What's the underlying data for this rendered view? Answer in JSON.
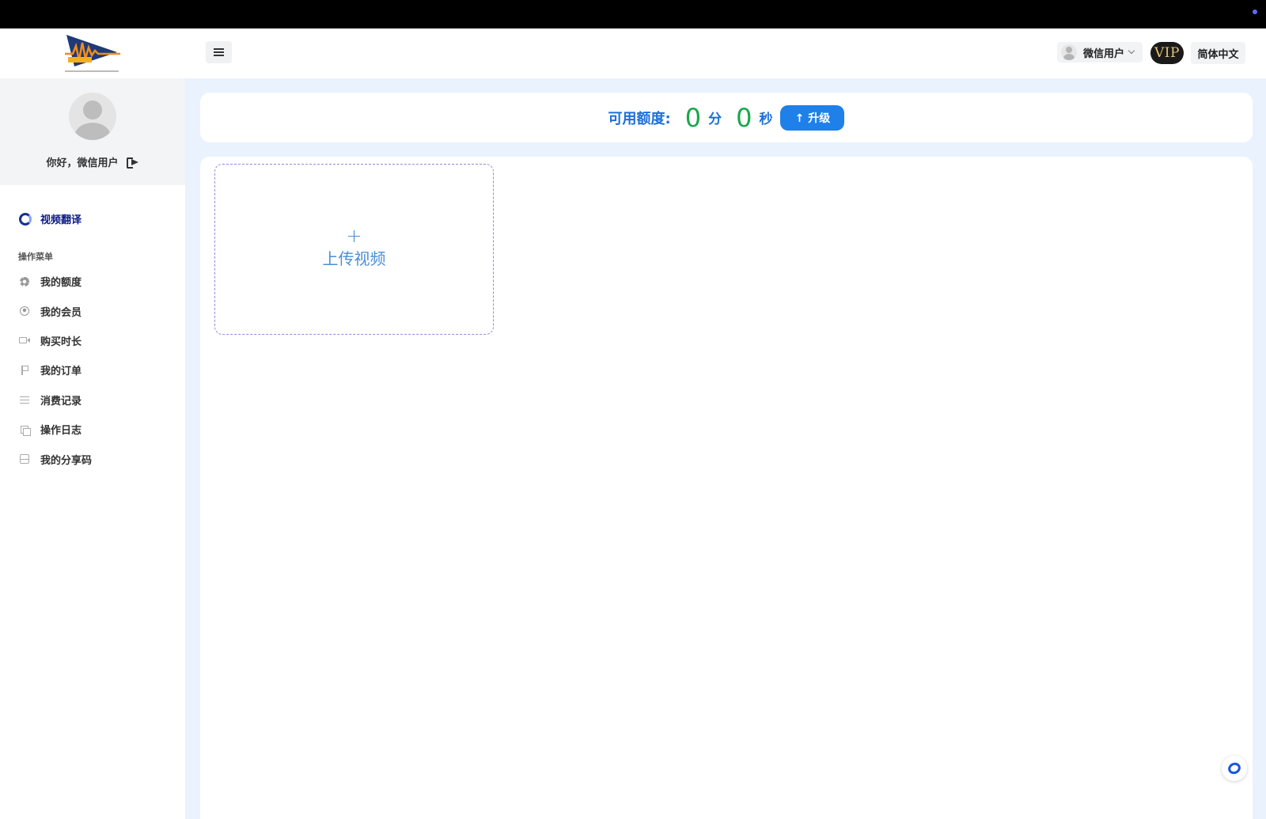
{
  "header": {
    "logo_alt": "logo",
    "user_name": "微信用户",
    "vip_label": "VIP",
    "language": "简体中文"
  },
  "sidebar": {
    "greeting": "你好，微信用户",
    "active_item": "视频翻译",
    "section_title": "操作菜单",
    "items": [
      {
        "label": "我的额度",
        "icon": "gear-icon"
      },
      {
        "label": "我的会员",
        "icon": "user-circle-icon"
      },
      {
        "label": "购买时长",
        "icon": "video-camera-icon"
      },
      {
        "label": "我的订单",
        "icon": "flag-icon"
      },
      {
        "label": "消费记录",
        "icon": "sliders-icon"
      },
      {
        "label": "操作日志",
        "icon": "copy-icon"
      },
      {
        "label": "我的分享码",
        "icon": "scan-code-icon"
      }
    ]
  },
  "quota": {
    "label": "可用额度:",
    "minutes": "0",
    "minutes_unit": "分",
    "seconds": "0",
    "seconds_unit": "秒",
    "upgrade_label": "↑ 升级"
  },
  "upload": {
    "plus": "+",
    "label": "上传视频"
  },
  "colors": {
    "accent_blue": "#1e80e8",
    "quota_green": "#18a84a",
    "nav_active": "#0b1a88",
    "main_bg": "#e9f2fd"
  }
}
